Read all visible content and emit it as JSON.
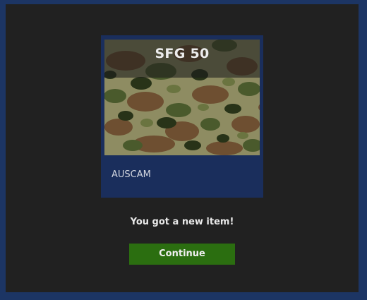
{
  "item": {
    "title": "SFG 50",
    "name": "AUSCAM",
    "image_icon": "camouflage-pattern-swatch"
  },
  "message": "You got a new item!",
  "continue_label": "Continue",
  "colors": {
    "background_border": "#1c3564",
    "dialog": "#212121",
    "card": "#1a2e5c",
    "button": "#2b6e10",
    "camo_base": "#8e8c62",
    "camo_brown": "#6e4f31",
    "camo_green": "#4a5a2c",
    "camo_dark": "#283318",
    "camo_olive": "#6a7440"
  }
}
